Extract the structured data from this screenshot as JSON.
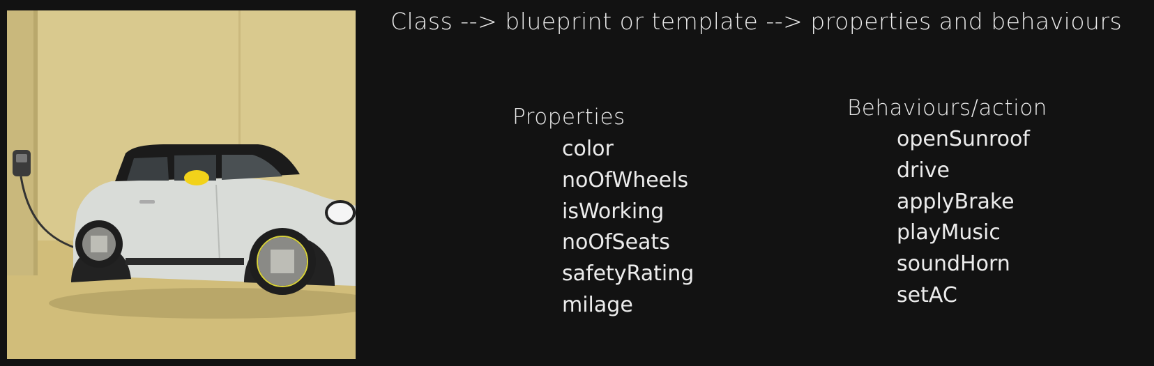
{
  "headline": "Class --> blueprint or template --> properties and behaviours",
  "properties": {
    "title": "Properties",
    "items": [
      "color",
      "noOfWheels",
      "isWorking",
      "noOfSeats",
      "safetyRating",
      "milage"
    ]
  },
  "behaviours": {
    "title": "Behaviours/action",
    "items": [
      "openSunroof",
      "drive",
      "applyBrake",
      "playMusic",
      "soundHorn",
      "setAC"
    ]
  },
  "colors": {
    "background": "#121212",
    "text": "#ececec",
    "photo_backdrop": "#d8c78a",
    "car_body": "#d9dcd8",
    "car_roof": "#1b1b1b",
    "mirror": "#f2d21a"
  }
}
